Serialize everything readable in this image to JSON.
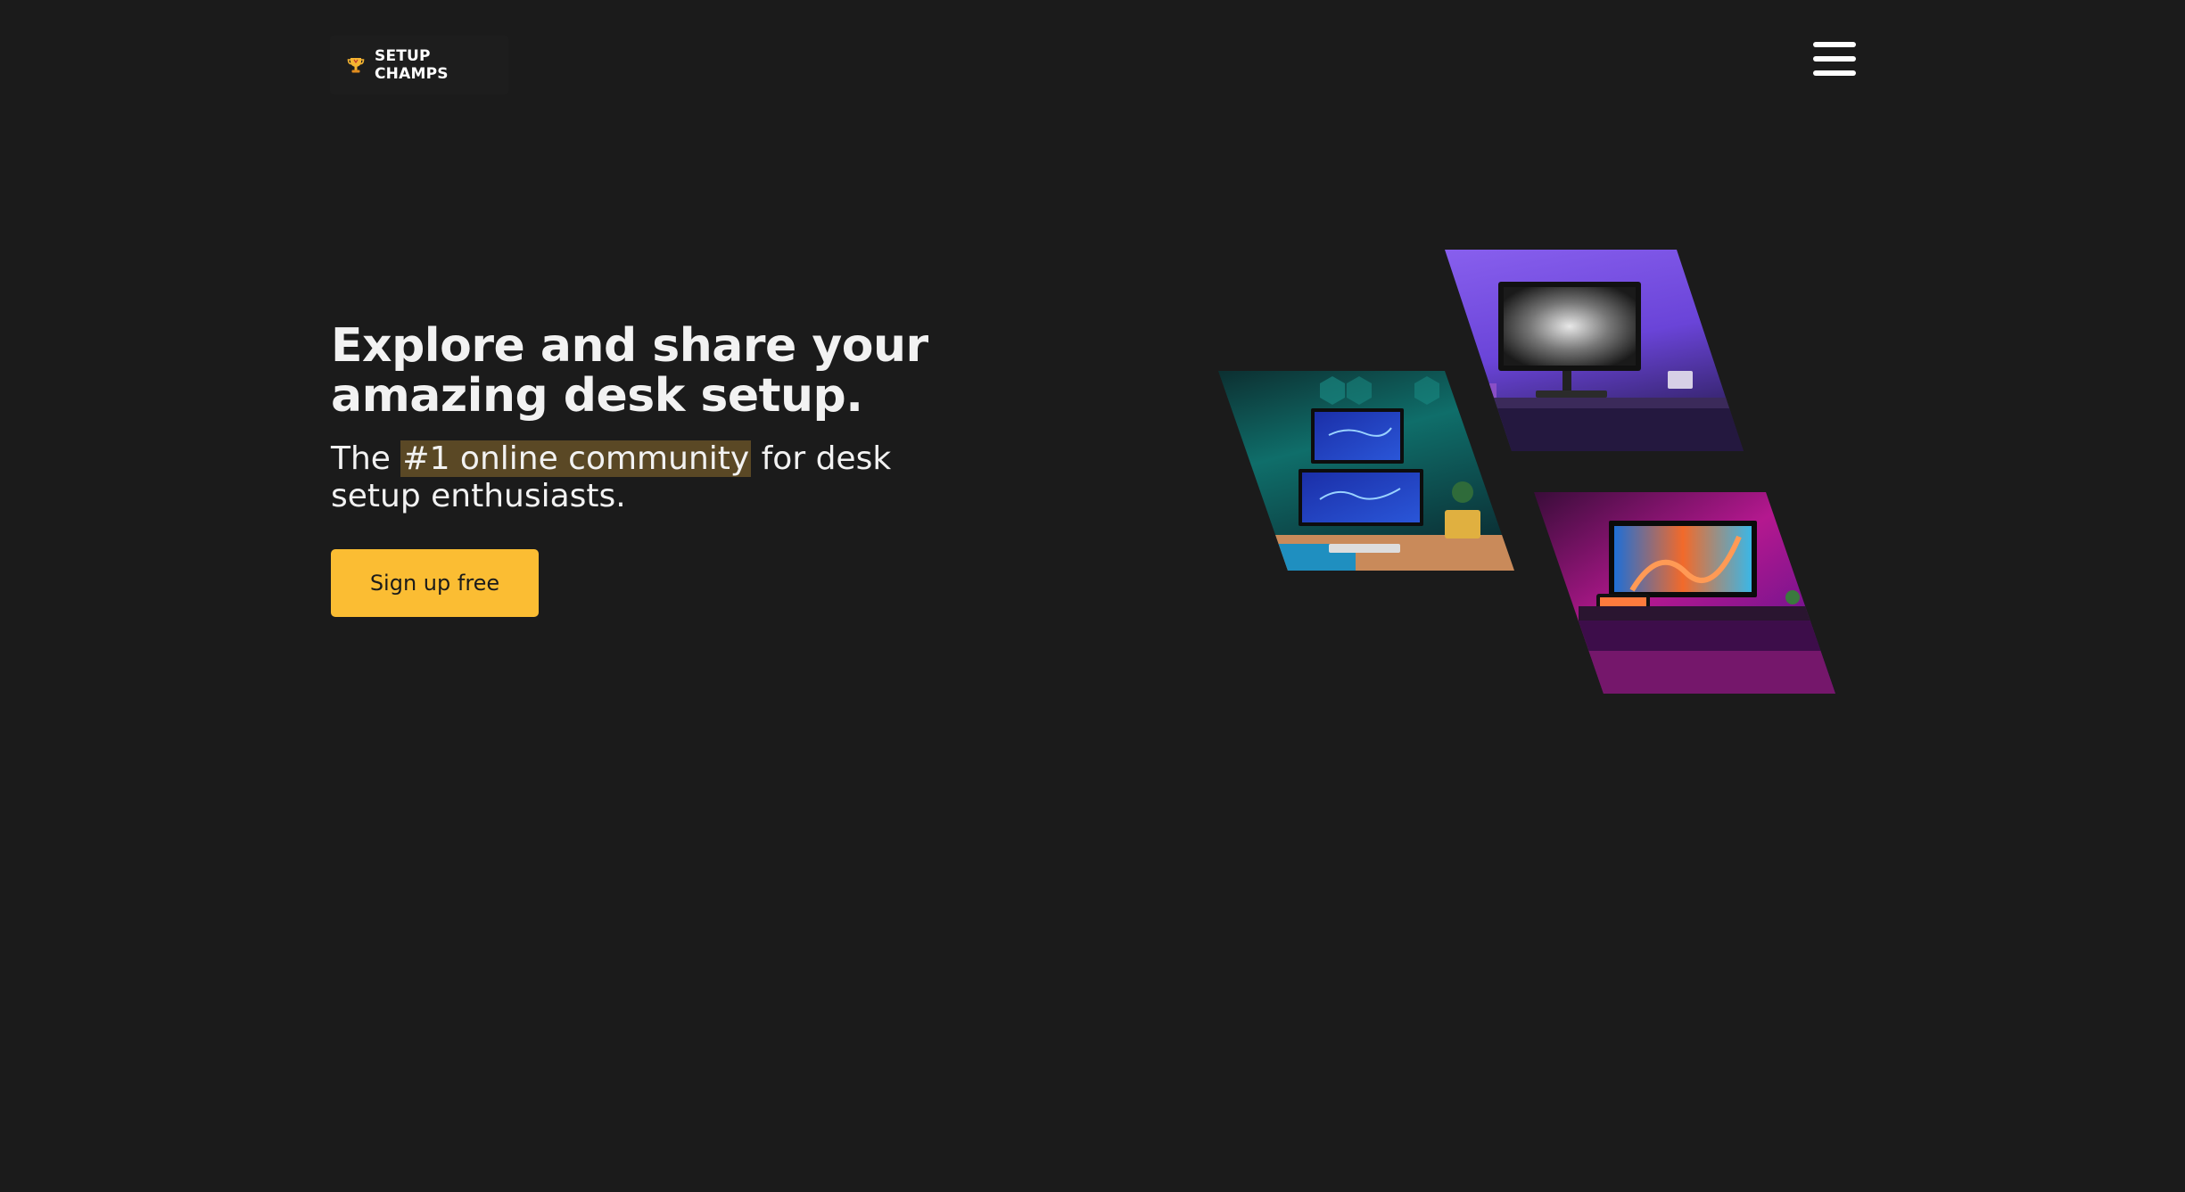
{
  "header": {
    "brand_name": "SETUP CHAMPS",
    "logo_icon": "trophy-icon",
    "menu_icon": "hamburger-menu-icon"
  },
  "hero": {
    "headline_line1": "Explore and share your",
    "headline_line2": "amazing desk setup.",
    "sub_prefix": "The ",
    "sub_highlight": "#1 online community",
    "sub_suffix": " for desk setup enthusiasts.",
    "cta_label": "Sign up free"
  },
  "gallery": {
    "images": [
      {
        "name": "purple-desk-setup",
        "description_icon": "monitor-icon"
      },
      {
        "name": "teal-desk-setup",
        "description_icon": "monitor-icon"
      },
      {
        "name": "magenta-desk-setup",
        "description_icon": "monitor-icon"
      }
    ]
  },
  "colors": {
    "background": "#1b1b1b",
    "accent": "#fbbd33",
    "highlight": "#5a4825",
    "text": "#f2f2f2"
  }
}
